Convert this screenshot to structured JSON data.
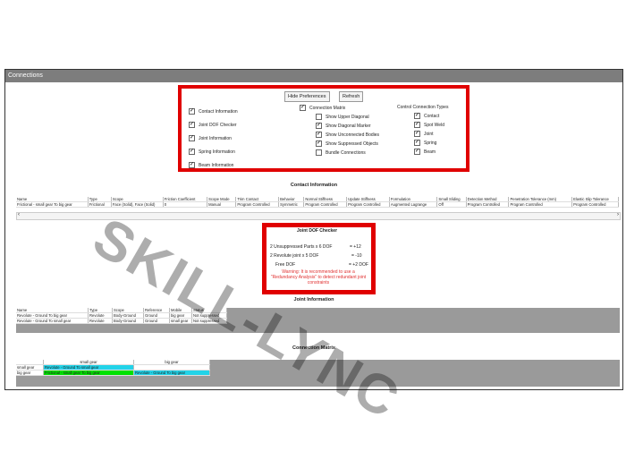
{
  "window": {
    "title": "Connections"
  },
  "preferences": {
    "hide_label": "Hide Preferences",
    "refresh_label": "Refresh",
    "col1": [
      {
        "label": "Contact Information",
        "checked": true
      },
      {
        "label": "Joint DOF Checker",
        "checked": true
      },
      {
        "label": "Joint Information",
        "checked": true
      },
      {
        "label": "Spring Information",
        "checked": true
      },
      {
        "label": "Beam Information",
        "checked": true
      }
    ],
    "col2_header": {
      "label": "Connection Matrix",
      "checked": true
    },
    "col2": [
      {
        "label": "Show Upper Diagonal",
        "checked": false
      },
      {
        "label": "Show Diagonal Marker",
        "checked": true
      },
      {
        "label": "Show Unconnected Bodies",
        "checked": true
      },
      {
        "label": "Show Suppressed Objects",
        "checked": true
      },
      {
        "label": "Bundle Connections",
        "checked": false
      }
    ],
    "col3_header": "Control Connection Types",
    "col3": [
      {
        "label": "Contact",
        "checked": true
      },
      {
        "label": "Spot Weld",
        "checked": true
      },
      {
        "label": "Joint",
        "checked": true
      },
      {
        "label": "Spring",
        "checked": true
      },
      {
        "label": "Beam",
        "checked": true
      }
    ]
  },
  "contact": {
    "title": "Contact Information",
    "headers": [
      "Name",
      "Type",
      "Scope",
      "Friction Coefficient",
      "Scope Mode",
      "Trim Contact",
      "Behavior",
      "Normal Stiffness",
      "Update Stiffness",
      "Formulation",
      "Small Sliding",
      "Detection Method",
      "Penetration Tolerance (mm)",
      "Elastic Slip Tolerance"
    ],
    "row": [
      "Frictional - small gear To big gear",
      "Frictional",
      "Face (Solid), Face (Solid)",
      "0",
      "Manual",
      "Program Controlled",
      "Symmetric",
      "Program Controlled",
      "Program Controlled",
      "Augmented Lagrange",
      "Off",
      "Program Controlled",
      "Program Controlled",
      "Program Controlled"
    ]
  },
  "dof": {
    "title": "Joint DOF Checker",
    "line1_label": "2 Unsuppressed Parts x 6 DOF",
    "line1_value": "= +12",
    "line2_label": "2 Revolute joint x 5 DOF",
    "line2_value": "= -10",
    "line3_label": "Free DOF",
    "line3_value": "= +2 DOF",
    "warning": "Warning: It is recommended to use a \"Redundancy Analysis\" to detect redundant joint constraints"
  },
  "joint": {
    "title": "Joint Information",
    "headers": [
      "Name",
      "Type",
      "Scope",
      "Reference",
      "Mobile",
      "Status"
    ],
    "rows": [
      [
        "Revolute - Ground To big gear",
        "Revolute",
        "Body-Ground",
        "Ground",
        "big gear",
        "Not suppressed"
      ],
      [
        "Revolute - Ground To small gear",
        "Revolute",
        "Body-Ground",
        "Ground",
        "small gear",
        "Not suppressed"
      ]
    ]
  },
  "matrix": {
    "title": "Connection Matrix",
    "col_headers": [
      "small gear",
      "big gear"
    ],
    "rows": [
      {
        "label": "small gear",
        "cells": [
          "Revolute - Ground To small gear",
          ""
        ]
      },
      {
        "label": "big gear",
        "cells": [
          "Frictional - small gear To big gear",
          "Revolute - Ground To big gear"
        ]
      }
    ],
    "colors": {
      "cyan": "#22d3e8",
      "green": "#00e000"
    }
  },
  "watermark": "SKILL-LYNC"
}
